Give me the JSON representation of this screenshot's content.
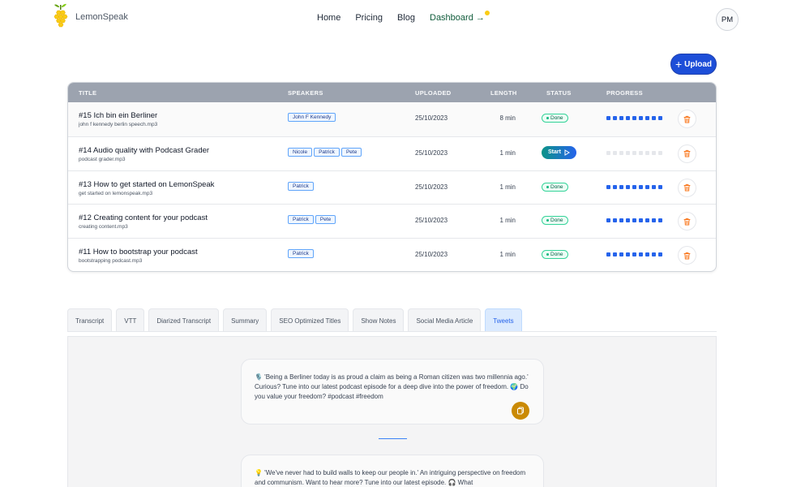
{
  "nav": {
    "logo_text": "LemonSpeak",
    "links": [
      "Home",
      "Pricing",
      "Blog",
      "Dashboard →"
    ],
    "avatar_initials": "PM"
  },
  "upload": {
    "label": "Upload"
  },
  "table": {
    "headers": [
      "TITLE",
      "SPEAKERS",
      "UPLOADED",
      "LENGTH",
      "STATUS",
      "PROGRESS"
    ],
    "rows": [
      {
        "title": "#15 Ich bin ein Berliner",
        "file": "john f kennedy berlin speech.mp3",
        "speakers": [
          "John F Kennedy"
        ],
        "uploaded": "25/10/2023",
        "length": "8 min",
        "status": "Done",
        "progress": 1
      },
      {
        "title": "#14 Audio quality with Podcast Grader",
        "file": "podcast grader.mp3",
        "speakers": [
          "Nicole",
          "Patrick",
          "Pete"
        ],
        "uploaded": "25/10/2023",
        "length": "1 min",
        "status": "Start",
        "progress": 0
      },
      {
        "title": "#13 How to get started on LemonSpeak",
        "file": "get started on lemonspeak.mp3",
        "speakers": [
          "Patrick"
        ],
        "uploaded": "25/10/2023",
        "length": "1 min",
        "status": "Done",
        "progress": 1
      },
      {
        "title": "#12 Creating content for your podcast",
        "file": "creating content.mp3",
        "speakers": [
          "Patrick",
          "Pete"
        ],
        "uploaded": "25/10/2023",
        "length": "1 min",
        "status": "Done",
        "progress": 1
      },
      {
        "title": "#11 How to bootstrap your podcast",
        "file": "bootstrapping podcast.mp3",
        "speakers": [
          "Patrick"
        ],
        "uploaded": "25/10/2023",
        "length": "1 min",
        "status": "Done",
        "progress": 1
      }
    ]
  },
  "tabs": [
    "Transcript",
    "VTT",
    "Diarized Transcript",
    "Summary",
    "SEO Optimized Titles",
    "Show Notes",
    "Social Media Article",
    "Tweets"
  ],
  "active_tab": "Tweets",
  "tweets": [
    "🎙️ 'Being a Berliner today is as proud a claim as being a Roman citizen was two millennia ago.' Curious? Tune into our latest podcast episode for a deep dive into the power of freedom. 🌍 Do you value your freedom? #podcast #freedom",
    "💡 'We've never had to build walls to keep our people in.' An intriguing perspective on freedom and communism. Want to hear more? Tune into our latest episode. 🎧 What"
  ],
  "colors": {
    "accent": "#1d4ed8",
    "done": "#10b981",
    "progress": "#2563eb",
    "delete": "#f97316",
    "copy": "#ca8a04"
  }
}
